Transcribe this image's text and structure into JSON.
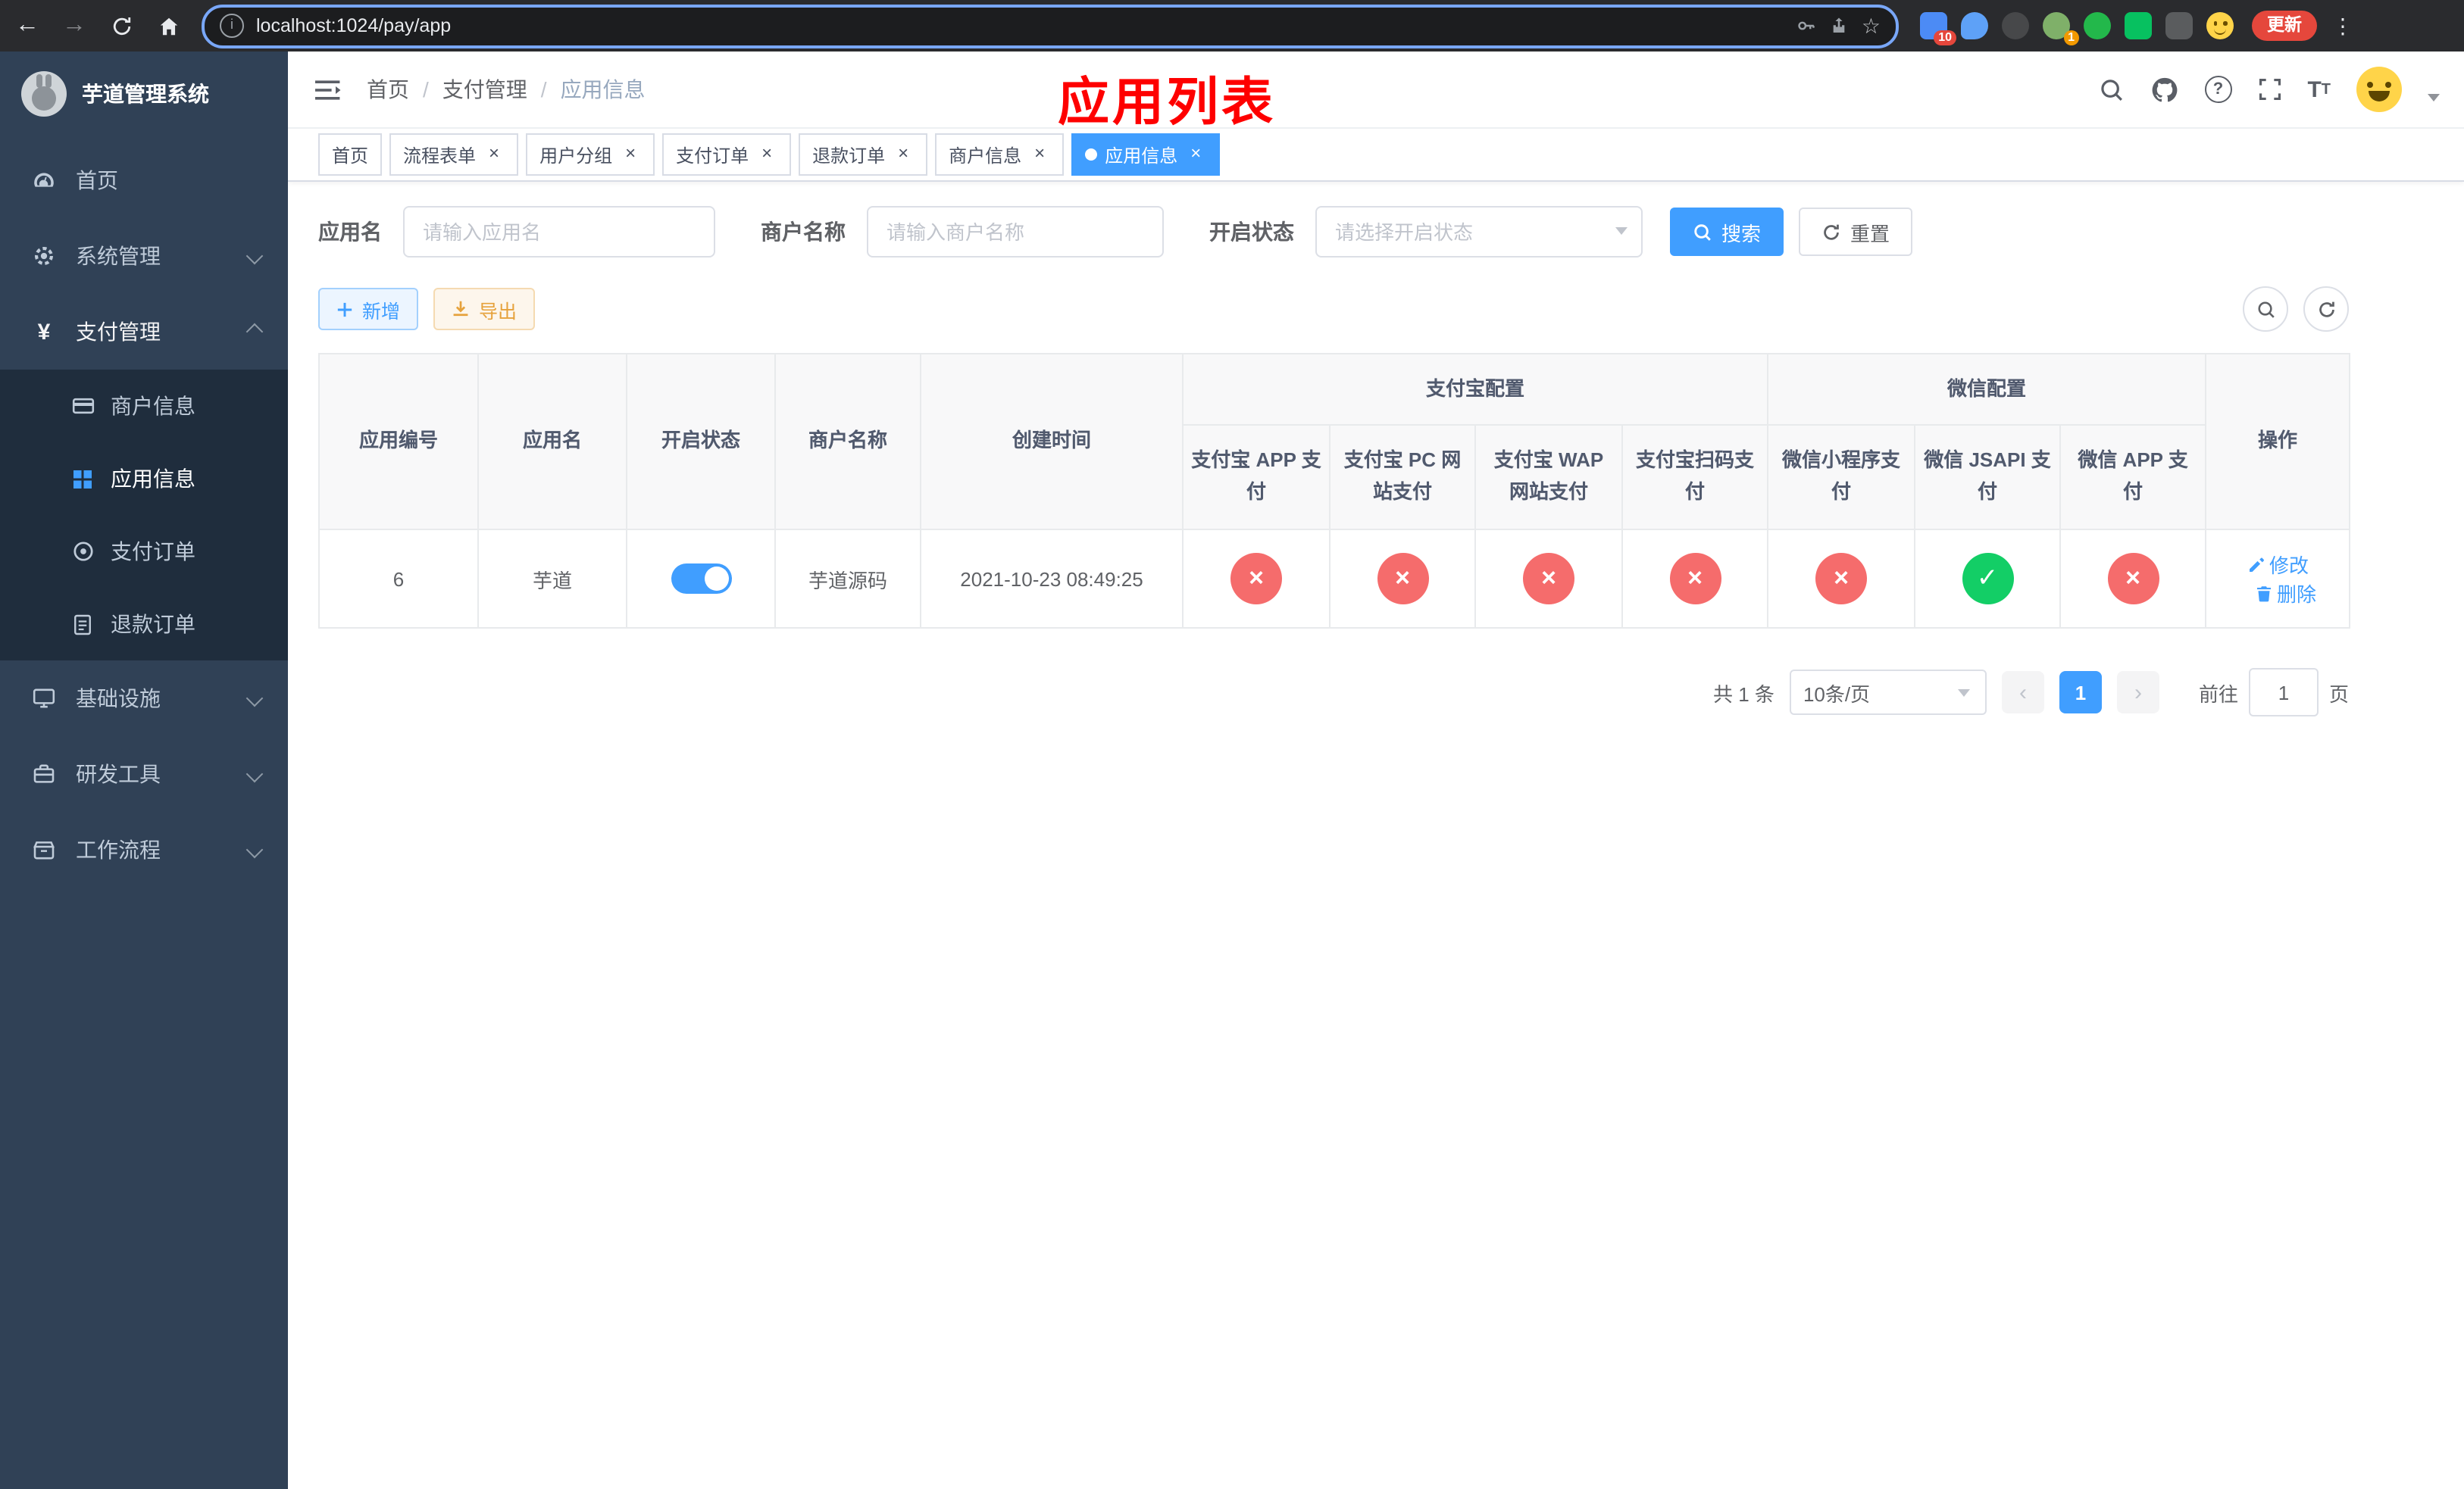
{
  "browser": {
    "url": "localhost:1024/pay/app",
    "update_button": "更新",
    "ext_badge_10": "10",
    "ext_badge_1": "1"
  },
  "sidebar": {
    "logo_title": "芋道管理系统",
    "items": [
      {
        "label": "首页"
      },
      {
        "label": "系统管理"
      },
      {
        "label": "支付管理",
        "children": [
          {
            "label": "商户信息"
          },
          {
            "label": "应用信息"
          },
          {
            "label": "支付订单"
          },
          {
            "label": "退款订单"
          }
        ]
      },
      {
        "label": "基础设施"
      },
      {
        "label": "研发工具"
      },
      {
        "label": "工作流程"
      }
    ]
  },
  "header": {
    "breadcrumb": [
      "首页",
      "支付管理",
      "应用信息"
    ],
    "annotation": "应用列表"
  },
  "tabs": [
    {
      "label": "首页"
    },
    {
      "label": "流程表单"
    },
    {
      "label": "用户分组"
    },
    {
      "label": "支付订单"
    },
    {
      "label": "退款订单"
    },
    {
      "label": "商户信息"
    },
    {
      "label": "应用信息"
    }
  ],
  "filters": {
    "app_name_label": "应用名",
    "app_name_placeholder": "请输入应用名",
    "merchant_label": "商户名称",
    "merchant_placeholder": "请输入商户名称",
    "status_label": "开启状态",
    "status_placeholder": "请选择开启状态",
    "search_button": "搜索",
    "reset_button": "重置"
  },
  "toolbar": {
    "add_button": "新增",
    "export_button": "导出"
  },
  "table": {
    "group_alipay": "支付宝配置",
    "group_wechat": "微信配置",
    "columns": [
      "应用编号",
      "应用名",
      "开启状态",
      "商户名称",
      "创建时间",
      "支付宝 APP 支付",
      "支付宝 PC 网站支付",
      "支付宝 WAP 网站支付",
      "支付宝扫码支付",
      "微信小程序支付",
      "微信 JSAPI 支付",
      "微信 APP 支付",
      "操作"
    ],
    "rows": [
      {
        "id": "6",
        "name": "芋道",
        "enabled": true,
        "merchant": "芋道源码",
        "created": "2021-10-23 08:49:25",
        "configs": [
          "no",
          "no",
          "no",
          "no",
          "no",
          "yes",
          "no"
        ],
        "edit": "修改",
        "delete": "删除"
      }
    ]
  },
  "pagination": {
    "total": "共 1 条",
    "page_size": "10条/页",
    "page": "1",
    "goto_label": "前往",
    "goto_value": "1",
    "page_unit": "页"
  }
}
